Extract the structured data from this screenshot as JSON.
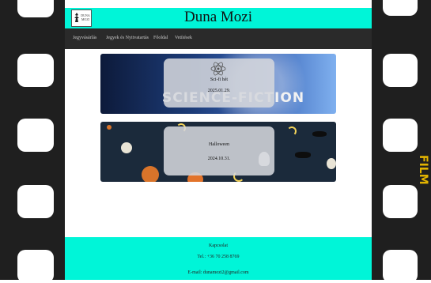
{
  "header": {
    "title": "Duna Mozi",
    "logo_text": "DUNA MOZI"
  },
  "nav": {
    "items": [
      {
        "label": "Jegyvásárlás"
      },
      {
        "label": "Jegyek és Nyitvatartás"
      },
      {
        "label": "Főoldal"
      },
      {
        "label": "Vetítések"
      }
    ]
  },
  "events": [
    {
      "title": "Sci-fi hét",
      "date": "2025.01.29.",
      "banner_text": "SCIENCE-FICTION"
    },
    {
      "title": "Halloween",
      "date": "2024.10.31."
    }
  ],
  "footer": {
    "heading": "Kapcsolat",
    "phone": "Tel.: +36 70 258 8769",
    "email": "E-mail: dunamozi2@gmail.com"
  },
  "film_strip": {
    "label": "FILM"
  },
  "colors": {
    "accent": "#00f5d8",
    "nav_bg": "#2a2a2a",
    "strip": "#1f1f1f"
  }
}
